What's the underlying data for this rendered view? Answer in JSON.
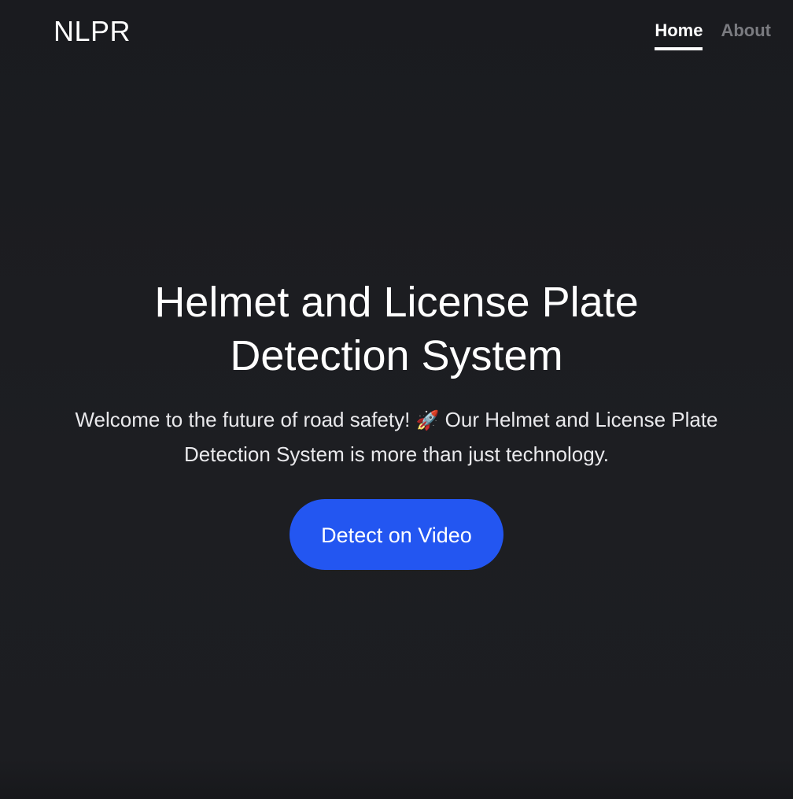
{
  "header": {
    "brand": "NLPR",
    "nav": [
      {
        "label": "Home",
        "active": true
      },
      {
        "label": "About",
        "active": false
      }
    ]
  },
  "hero": {
    "title": "Helmet and License Plate Detection System",
    "text_before_icon": "Welcome to the future of road safety! ",
    "icon": "rocket-icon",
    "icon_glyph": "🚀",
    "text_after_icon": " Our Helmet and License Plate Detection System is more than just technology.",
    "cta_label": "Detect on Video"
  },
  "colors": {
    "background": "#1c1d21",
    "accent": "#2356f1",
    "nav_inactive": "#7a7b80",
    "text": "#ffffff"
  }
}
